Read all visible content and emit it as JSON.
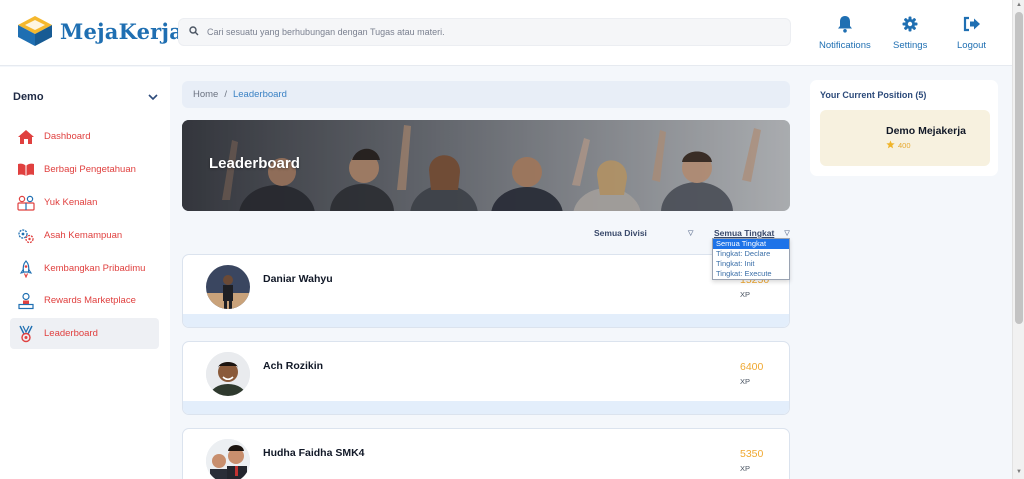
{
  "brand": {
    "name": "MejaKerja"
  },
  "search": {
    "placeholder": "Cari sesuatu yang berhubungan dengan Tugas atau materi."
  },
  "header_actions": [
    {
      "label": "Notifications",
      "icon": "bell-icon"
    },
    {
      "label": "Settings",
      "icon": "gear-icon"
    },
    {
      "label": "Logout",
      "icon": "logout-icon"
    }
  ],
  "sidebar": {
    "title": "Demo",
    "items": [
      {
        "label": "Dashboard",
        "icon": "home-icon"
      },
      {
        "label": "Berbagi Pengetahuan",
        "icon": "book-icon"
      },
      {
        "label": "Yuk Kenalan",
        "icon": "people-icon"
      },
      {
        "label": "Asah Kemampuan",
        "icon": "gears-icon"
      },
      {
        "label": "Kembangkan Pribadimu",
        "icon": "rocket-icon"
      },
      {
        "label": "Rewards Marketplace",
        "icon": "reward-icon"
      },
      {
        "label": "Leaderboard",
        "icon": "medal-icon",
        "active": true
      }
    ]
  },
  "breadcrumb": {
    "home": "Home",
    "separator": "/",
    "current": "Leaderboard"
  },
  "banner": {
    "title": "Leaderboard"
  },
  "filters": {
    "division": "Semua Divisi",
    "level": "Semua Tingkat",
    "level_options": [
      "Semua Tingkat",
      "Tingkat: Declare",
      "Tingkat: Init",
      "Tingkat: Execute"
    ],
    "selected_option": "Semua Tingkat"
  },
  "leaderboard": [
    {
      "name": "Daniar Wahyu",
      "xp": "15250",
      "xp_unit": "XP"
    },
    {
      "name": "Ach Rozikin",
      "xp": "6400",
      "xp_unit": "XP"
    },
    {
      "name": "Hudha Faidha SMK4",
      "xp": "5350",
      "xp_unit": "XP"
    }
  ],
  "current_position": {
    "title": "Your Current Position (5)",
    "name": "Demo Mejakerja",
    "xp": "400"
  },
  "colors": {
    "brand": "#1f6fb2",
    "menu_text": "#e0403f",
    "xp": "#f0a830",
    "dropdown_selected": "#1e73e8"
  }
}
